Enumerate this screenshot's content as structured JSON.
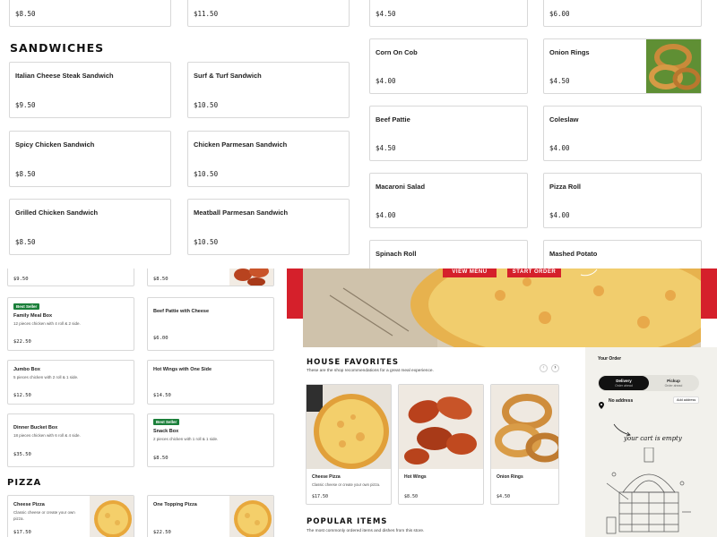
{
  "top_left": {
    "row0": [
      {
        "price": "$8.50"
      },
      {
        "price": "$11.50"
      }
    ],
    "sandwiches_title": "SANDWICHES",
    "sandwiches": [
      {
        "name": "Italian Cheese Steak Sandwich",
        "price": "$9.50"
      },
      {
        "name": "Surf & Turf Sandwich",
        "price": "$10.50"
      },
      {
        "name": "Spicy Chicken Sandwich",
        "price": "$8.50"
      },
      {
        "name": "Chicken Parmesan Sandwich",
        "price": "$10.50"
      },
      {
        "name": "Grilled Chicken Sandwich",
        "price": "$8.50"
      },
      {
        "name": "Meatball Parmesan Sandwich",
        "price": "$10.50"
      }
    ]
  },
  "top_right": {
    "row0": [
      {
        "price": "$4.50"
      },
      {
        "price": "$6.00"
      }
    ],
    "sides": [
      {
        "name": "Corn On Cob",
        "price": "$4.00"
      },
      {
        "name": "Onion Rings",
        "price": "$4.50"
      },
      {
        "name": "Beef Pattie",
        "price": "$4.50"
      },
      {
        "name": "Coleslaw",
        "price": "$4.00"
      },
      {
        "name": "Macaroni Salad",
        "price": "$4.00"
      },
      {
        "name": "Pizza Roll",
        "price": "$4.00"
      },
      {
        "name": "Spinach Roll",
        "price": ""
      },
      {
        "name": "Mashed Potato",
        "price": ""
      }
    ]
  },
  "bottom_left": {
    "row0": [
      {
        "price": "$9.50"
      },
      {
        "price": "$8.50"
      }
    ],
    "boxes": [
      {
        "badge": "Best Seller",
        "name": "Family Meal Box",
        "desc": "12 pieces chicken with 4 roll & 2 side.",
        "price": "$22.50"
      },
      {
        "name": "Beef Pattie with Cheese",
        "price": "$6.00"
      },
      {
        "name": "Jumbo Box",
        "desc": "5 pieces chicken with 2 roll & 1 side.",
        "price": "$12.50"
      },
      {
        "name": "Hot Wings with One Side",
        "price": "$14.50"
      },
      {
        "name": "Dinner Bucket Box",
        "desc": "18 pieces chicken with 6 roll & 4 side.",
        "price": "$35.50"
      },
      {
        "badge": "Best Seller",
        "name": "Snack Box",
        "desc": "2 pieces chicken with 1 roll & 1 side.",
        "price": "$8.50"
      }
    ],
    "pizza_title": "PIZZA",
    "pizzas": [
      {
        "name": "Cheese Pizza",
        "desc": "Classic cheese or create your own pizza.",
        "price": "$17.50"
      },
      {
        "name": "One Topping Pizza",
        "price": "$22.50"
      }
    ]
  },
  "hero": {
    "view_menu": "VIEW MENU",
    "start_order": "START ORDER"
  },
  "house": {
    "title": "HOUSE FAVORITES",
    "subtitle": "These are the shop recommendations for a great meal experience.",
    "items": [
      {
        "name": "Cheese Pizza",
        "desc": "Classic cheese or create your own pizza.",
        "price": "$17.50"
      },
      {
        "name": "Hot Wings",
        "price": "$8.50"
      },
      {
        "name": "Onion Rings",
        "price": "$4.50"
      }
    ],
    "prev_icon": "chevron-left-icon",
    "next_icon": "chevron-right-icon"
  },
  "popular": {
    "title": "POPULAR ITEMS",
    "subtitle": "The most commonly ordered items and dishes from this store."
  },
  "order": {
    "title": "Your Order",
    "delivery": "Delivery",
    "delivery_sub": "Order ahead",
    "pickup": "Pickup",
    "pickup_sub": "Order ahead",
    "no_address": "No address",
    "add_address": "Add address",
    "empty": "your cart is empty"
  },
  "colors": {
    "accent": "#d5202b",
    "badge": "#1b7f3a"
  }
}
